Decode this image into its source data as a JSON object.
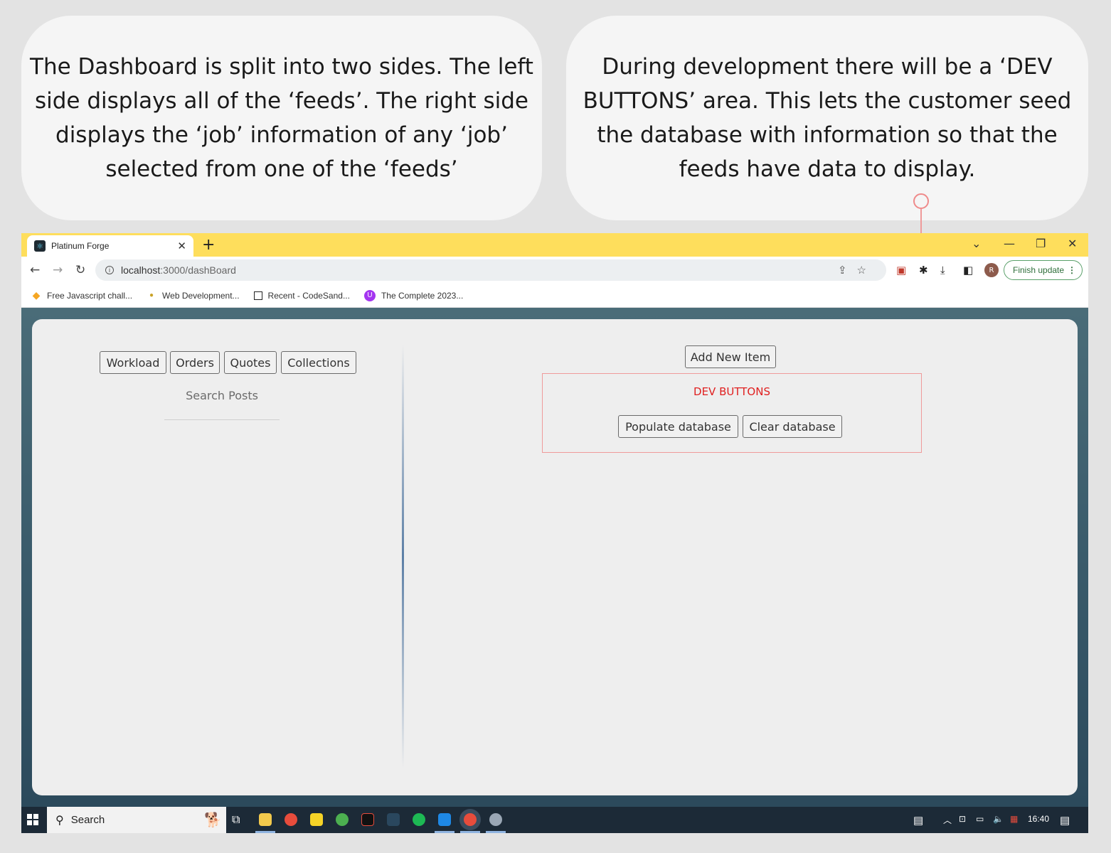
{
  "callouts": {
    "left_text": "The Dashboard is split into two sides. The left side displays all of the ‘feeds’. The right side displays the ‘job’ information of any ‘job’ selected from one of the ‘feeds’",
    "right_text": "During development there will be a ‘DEV BUTTONS’ area. This lets the customer seed the database with information so that the feeds have data to display."
  },
  "browser": {
    "tab_title": "Platinum Forge",
    "url_host": "localhost",
    "url_rest": ":3000/dashBoard",
    "finish_update": "Finish update",
    "avatar_initial": "R",
    "bookmarks": [
      {
        "label": "Free Javascript chall...",
        "icon": "diamond-icon",
        "color": "#f5a623"
      },
      {
        "label": "Web Development...",
        "icon": "bulb-icon",
        "color": "#c9a227"
      },
      {
        "label": "Recent - CodeSand...",
        "icon": "square-icon",
        "color": "#222222"
      },
      {
        "label": "The Complete 2023...",
        "icon": "udemy-icon",
        "color": "#a435f0"
      }
    ]
  },
  "dashboard": {
    "feed_tabs": [
      "Workload",
      "Orders",
      "Quotes",
      "Collections"
    ],
    "search_label": "Search Posts",
    "add_new_item": "Add New Item",
    "dev_label": "DEV BUTTONS",
    "populate": "Populate database",
    "clear": "Clear database"
  },
  "taskbar": {
    "search": "Search",
    "time": "16:40"
  },
  "colors": {
    "tabbar": "#fede5c",
    "dev_border": "#ef9a9a",
    "dev_label": "#e02020",
    "finish_green": "#5aa06a"
  }
}
